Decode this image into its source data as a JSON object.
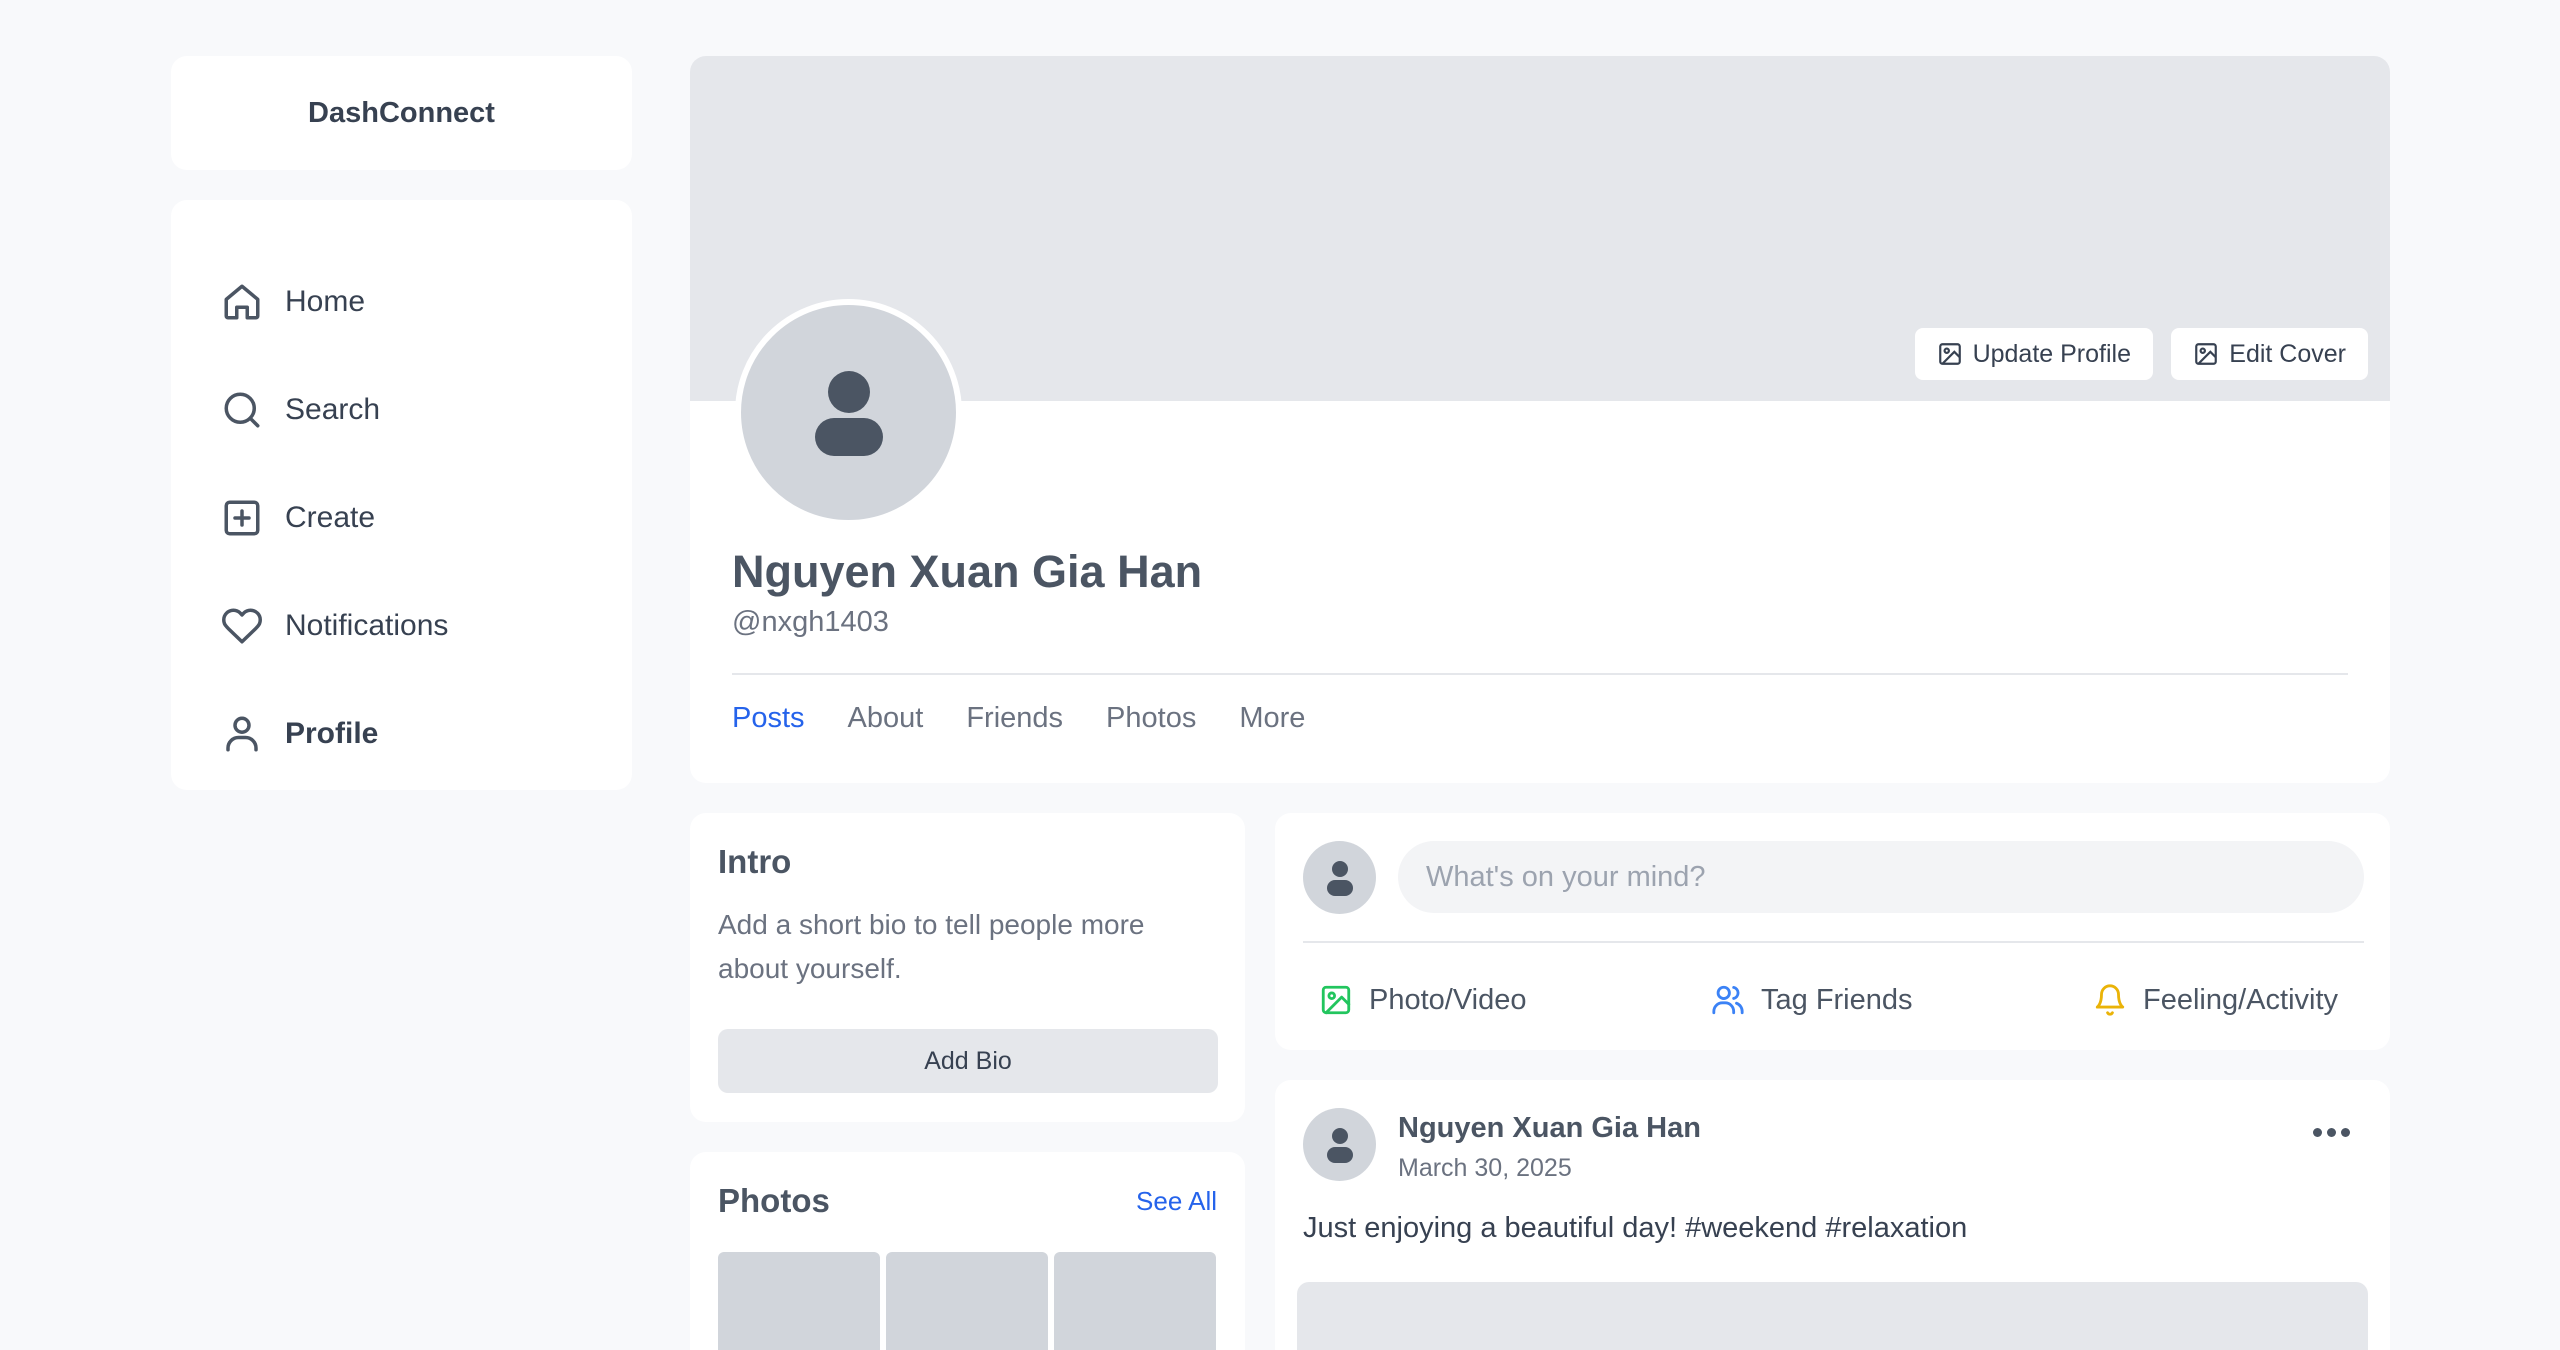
{
  "app": {
    "brand": "DashConnect"
  },
  "sidebar": {
    "items": [
      {
        "label": "Home",
        "icon": "home-icon"
      },
      {
        "label": "Search",
        "icon": "search-icon"
      },
      {
        "label": "Create",
        "icon": "plus-square-icon"
      },
      {
        "label": "Notifications",
        "icon": "heart-icon"
      },
      {
        "label": "Profile",
        "icon": "user-icon"
      }
    ],
    "active": "Profile"
  },
  "profile": {
    "name": "Nguyen Xuan Gia Han",
    "handle": "@nxgh1403",
    "update_profile_label": "Update Profile",
    "edit_cover_label": "Edit Cover",
    "tabs": [
      "Posts",
      "About",
      "Friends",
      "Photos",
      "More"
    ],
    "active_tab": "Posts"
  },
  "intro": {
    "title": "Intro",
    "text": "Add a short bio to tell people more about yourself.",
    "button": "Add Bio"
  },
  "photos": {
    "title": "Photos",
    "see_all": "See All"
  },
  "composer": {
    "placeholder": "What's on your mind?",
    "actions": [
      {
        "label": "Photo/Video",
        "icon": "image-icon",
        "color": "#22c55e"
      },
      {
        "label": "Tag Friends",
        "icon": "users-icon",
        "color": "#3b82f6"
      },
      {
        "label": "Feeling/Activity",
        "icon": "bell-icon",
        "color": "#eab308"
      }
    ]
  },
  "post": {
    "author": "Nguyen Xuan Gia Han",
    "date": "March 30, 2025",
    "text": "Just enjoying a beautiful day! #weekend #relaxation"
  },
  "colors": {
    "accent": "#2563eb",
    "background": "#f8f9fb",
    "card": "#ffffff"
  }
}
